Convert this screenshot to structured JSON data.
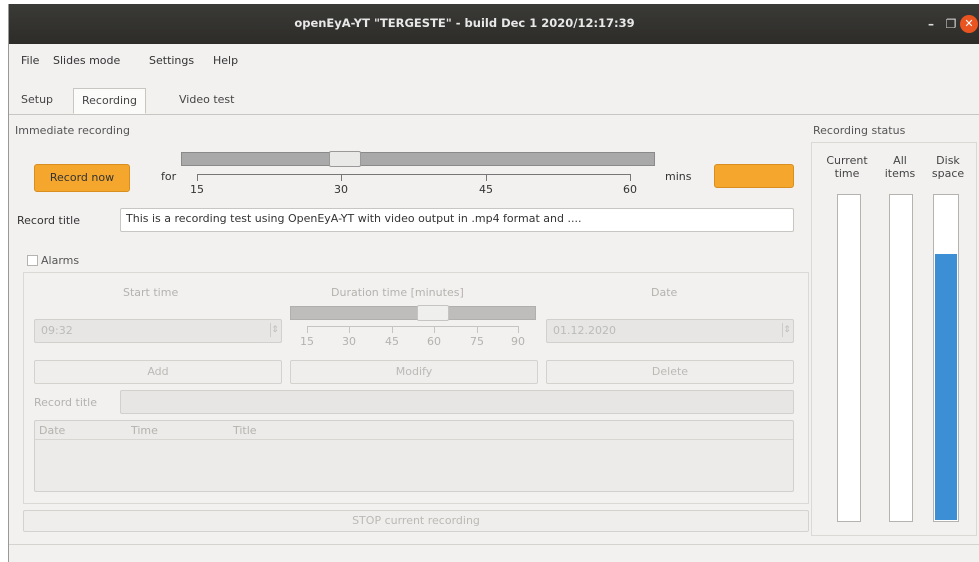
{
  "window": {
    "title": "openEyA-YT \"TERGESTE\" - build Dec  1 2020/12:17:39",
    "minimize": "–",
    "maximize": "❐",
    "close": "✕"
  },
  "menu": [
    "File",
    "Slides mode",
    "Settings",
    "Help"
  ],
  "tabs": [
    "Setup",
    "Recording",
    "Video test"
  ],
  "immediate": {
    "section_label": "Immediate recording",
    "record_now": "Record now",
    "for_label": "for",
    "slider_value": 30,
    "slider_ticks": [
      "15",
      "30",
      "45",
      "60"
    ],
    "mins_label": "mins",
    "record_title_label": "Record title",
    "record_title_value": "This is a recording test using OpenEyA-YT with video output in .mp4 format and ...."
  },
  "alarms": {
    "checkbox_label": "Alarms",
    "checked": false,
    "start_time_label": "Start time",
    "duration_label": "Duration time [minutes]",
    "date_label": "Date",
    "start_time_value": "09:32",
    "date_value": "01.12.2020",
    "duration_ticks": [
      "15",
      "30",
      "45",
      "60",
      "75",
      "90"
    ],
    "add": "Add",
    "modify": "Modify",
    "delete": "Delete",
    "record_title_label": "Record title",
    "columns": [
      "Date",
      "Time",
      "Title"
    ]
  },
  "stop_button": "STOP current recording",
  "status": {
    "section_label": "Recording status",
    "columns": [
      {
        "label_1": "Current",
        "label_2": "time",
        "fill": 0
      },
      {
        "label_1": "All",
        "label_2": "items",
        "fill": 0
      },
      {
        "label_1": "Disk",
        "label_2": "space",
        "fill": 0.82
      }
    ]
  },
  "colors": {
    "accent_orange": "#f4a72c",
    "disk_bar_blue": "#3c8fd4",
    "close_button": "#e95420"
  }
}
